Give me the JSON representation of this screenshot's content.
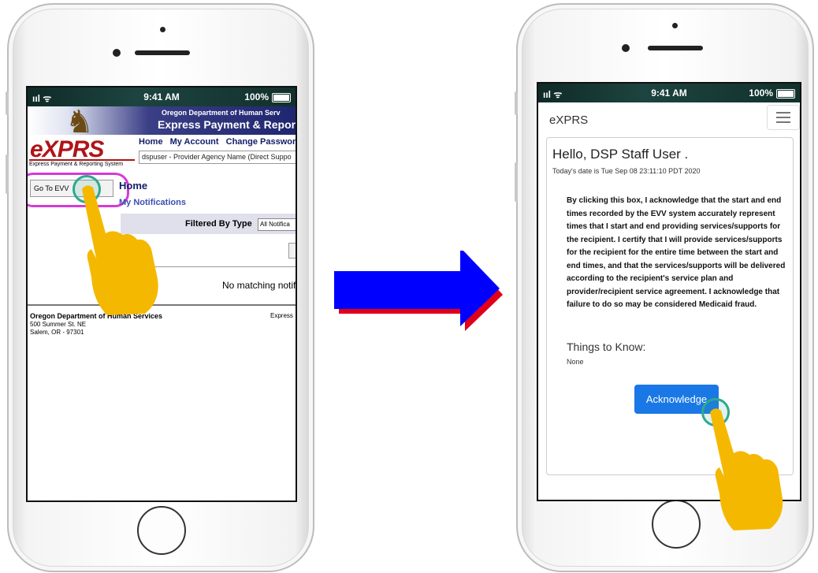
{
  "status_bar": {
    "signal": "ııl ᯤ",
    "time": "9:41 AM",
    "battery": "100%"
  },
  "left_screen": {
    "agency": "Oregon Department of Human Serv",
    "app_title": "Express Payment & Report",
    "logo": "eXPRS",
    "logo_subtitle": "Express Payment & Reporting System",
    "nav": [
      "Home",
      "My Account",
      "Change Password"
    ],
    "user_select": "dspuser - Provider Agency Name (Direct Suppo",
    "go_to_evv": "Go To EVV",
    "home_heading": "Home",
    "my_notifications": "My Notifications",
    "filter_label": "Filtered By Type",
    "filter_value": "All Notifica",
    "h_button": "H",
    "no_matching": "No matching notifi",
    "footer_org": "Oregon Department of Human Services",
    "footer_address1": "500 Summer St. NE",
    "footer_address2": "Salem, OR - 97301",
    "footer_right": "Express"
  },
  "right_screen": {
    "brand": "eXPRS",
    "greeting": "Hello, DSP Staff User .",
    "date_line": "Today's date is Tue Sep 08 23:11:10 PDT 2020",
    "consent_text": "By clicking this box, I acknowledge that the start and end times recorded by the EVV system accurately represent times that I start and end providing services/supports for the recipient. I certify that I will provide services/supports for the recipient for the entire time between the start and end times, and that the services/supports will be delivered according to the recipient's service plan and provider/recipient service agreement. I acknowledge that failure to do so may be considered Medicaid fraud.",
    "things_to_know": "Things to Know:",
    "things_value": "None",
    "acknowledge_button": "Acknowledge"
  },
  "colors": {
    "arrow": "#0000ff",
    "arrow_shadow": "#e0001a",
    "hand": "#f5b800",
    "highlight_ring": "#d63ad6",
    "touch_ring": "#2fa890",
    "acknowledge_button": "#1a78e6",
    "exprs_red": "#b01418"
  },
  "icons": [
    "hand-pointer-icon",
    "hamburger-menu-icon",
    "horse-rider-logo-icon",
    "arrow-right-icon"
  ]
}
